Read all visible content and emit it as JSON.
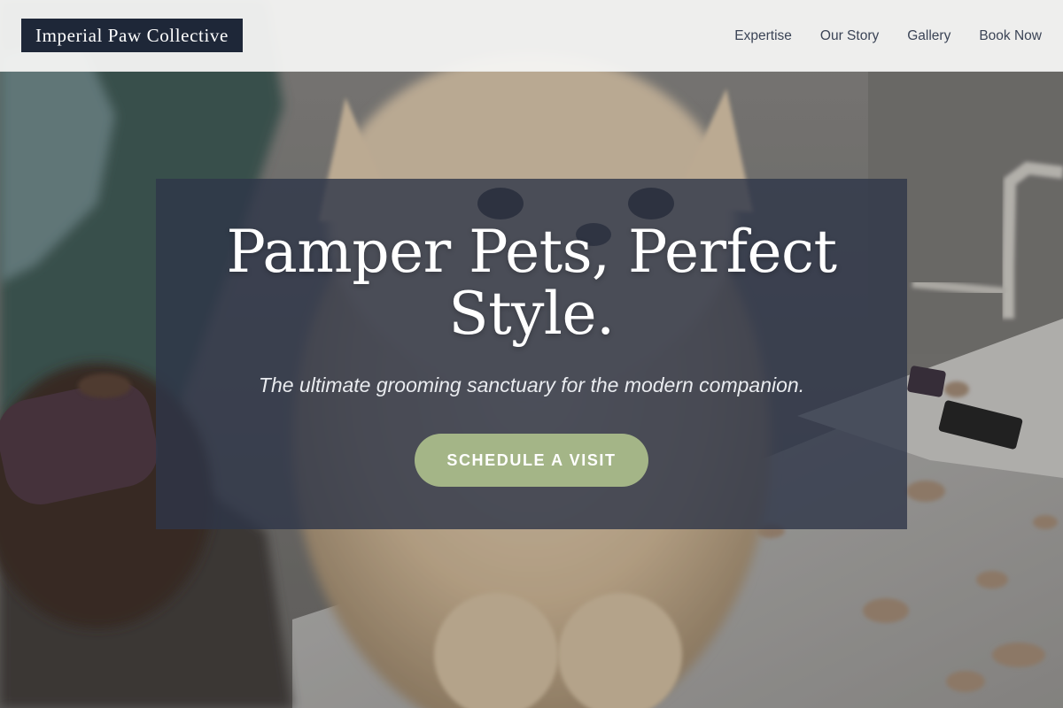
{
  "header": {
    "logo_text": "Imperial Paw Collective",
    "nav": [
      {
        "label": "Expertise"
      },
      {
        "label": "Our Story"
      },
      {
        "label": "Gallery"
      },
      {
        "label": "Book Now"
      }
    ]
  },
  "hero": {
    "title": "Pamper Pets, Perfect Style.",
    "tagline": "The ultimate grooming sanctuary for the modern companion.",
    "cta_label": "SCHEDULE A VISIT"
  },
  "colors": {
    "logo_bg": "#1e2738",
    "nav_text": "#3b4456",
    "card_overlay": "#2e3648",
    "cta_bg": "#a4b587"
  }
}
